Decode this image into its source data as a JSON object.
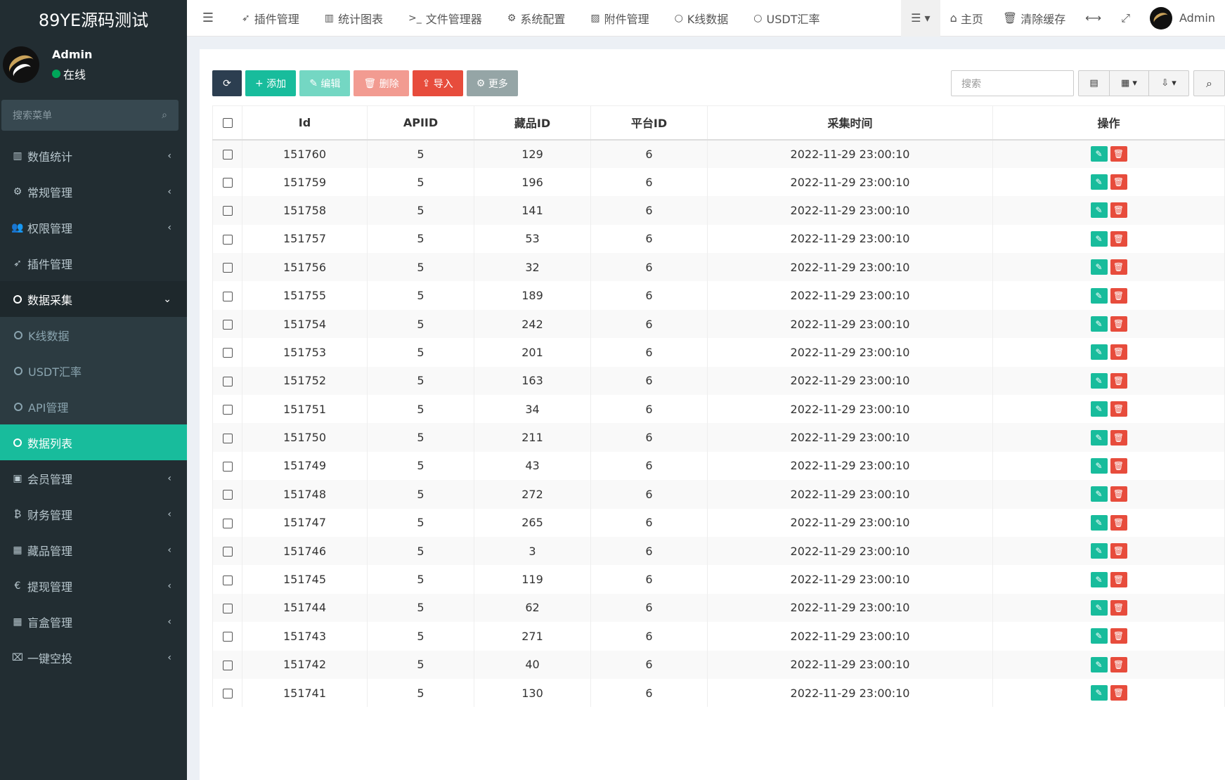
{
  "app": {
    "brand": "89YE源码测试"
  },
  "user": {
    "name": "Admin",
    "status": "在线"
  },
  "sidebar": {
    "search_placeholder": "搜索菜单",
    "items": [
      {
        "label": "数值统计",
        "icon": "bar-chart-icon"
      },
      {
        "label": "常规管理",
        "icon": "cogs-icon"
      },
      {
        "label": "权限管理",
        "icon": "users-icon"
      },
      {
        "label": "插件管理",
        "icon": "rocket-icon"
      },
      {
        "label": "数据采集",
        "icon": "circle-icon"
      },
      {
        "label": "K线数据",
        "icon": "circle-icon"
      },
      {
        "label": "USDT汇率",
        "icon": "circle-icon"
      },
      {
        "label": "API管理",
        "icon": "circle-icon"
      },
      {
        "label": "数据列表",
        "icon": "circle-icon"
      },
      {
        "label": "会员管理",
        "icon": "id-card-icon"
      },
      {
        "label": "财务管理",
        "icon": "bitcoin-icon"
      },
      {
        "label": "藏品管理",
        "icon": "calendar-icon"
      },
      {
        "label": "提现管理",
        "icon": "euro-icon"
      },
      {
        "label": "盲盒管理",
        "icon": "grid-icon"
      },
      {
        "label": "一键空投",
        "icon": "crossed-icon"
      }
    ]
  },
  "topnav": {
    "items": [
      "插件管理",
      "统计图表",
      "文件管理器",
      "系统配置",
      "附件管理",
      "K线数据",
      "USDT汇率"
    ],
    "home": "主页",
    "clear_cache": "清除缓存",
    "user": "Admin"
  },
  "toolbar": {
    "add": "添加",
    "edit": "编辑",
    "delete": "删除",
    "import": "导入",
    "more": "更多",
    "search_placeholder": "搜索"
  },
  "table": {
    "headers": [
      "Id",
      "APIID",
      "藏品ID",
      "平台ID",
      "采集时间",
      "操作"
    ],
    "rows": [
      [
        "151760",
        "5",
        "129",
        "6",
        "2022-11-29 23:00:10"
      ],
      [
        "151759",
        "5",
        "196",
        "6",
        "2022-11-29 23:00:10"
      ],
      [
        "151758",
        "5",
        "141",
        "6",
        "2022-11-29 23:00:10"
      ],
      [
        "151757",
        "5",
        "53",
        "6",
        "2022-11-29 23:00:10"
      ],
      [
        "151756",
        "5",
        "32",
        "6",
        "2022-11-29 23:00:10"
      ],
      [
        "151755",
        "5",
        "189",
        "6",
        "2022-11-29 23:00:10"
      ],
      [
        "151754",
        "5",
        "242",
        "6",
        "2022-11-29 23:00:10"
      ],
      [
        "151753",
        "5",
        "201",
        "6",
        "2022-11-29 23:00:10"
      ],
      [
        "151752",
        "5",
        "163",
        "6",
        "2022-11-29 23:00:10"
      ],
      [
        "151751",
        "5",
        "34",
        "6",
        "2022-11-29 23:00:10"
      ],
      [
        "151750",
        "5",
        "211",
        "6",
        "2022-11-29 23:00:10"
      ],
      [
        "151749",
        "5",
        "43",
        "6",
        "2022-11-29 23:00:10"
      ],
      [
        "151748",
        "5",
        "272",
        "6",
        "2022-11-29 23:00:10"
      ],
      [
        "151747",
        "5",
        "265",
        "6",
        "2022-11-29 23:00:10"
      ],
      [
        "151746",
        "5",
        "3",
        "6",
        "2022-11-29 23:00:10"
      ],
      [
        "151745",
        "5",
        "119",
        "6",
        "2022-11-29 23:00:10"
      ],
      [
        "151744",
        "5",
        "62",
        "6",
        "2022-11-29 23:00:10"
      ],
      [
        "151743",
        "5",
        "271",
        "6",
        "2022-11-29 23:00:10"
      ],
      [
        "151742",
        "5",
        "40",
        "6",
        "2022-11-29 23:00:10"
      ],
      [
        "151741",
        "5",
        "130",
        "6",
        "2022-11-29 23:00:10"
      ]
    ]
  },
  "colors": {
    "sidebar_bg": "#222d32",
    "accent": "#18bc9c",
    "danger": "#e74c3c"
  }
}
